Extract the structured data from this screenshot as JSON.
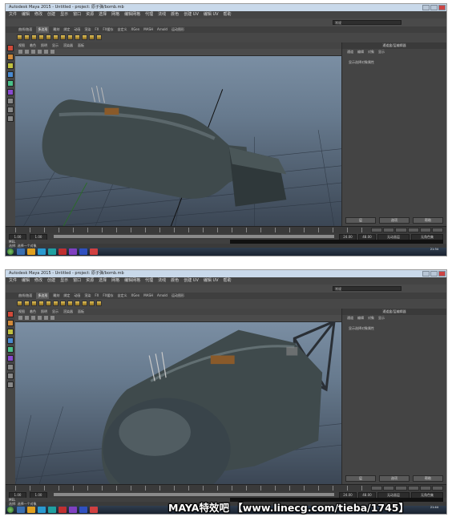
{
  "screens": [
    {
      "window_title": "Autodesk Maya 2015 - Untitled - project: 原子弹/bomb.mb",
      "menus": [
        "文件",
        "编辑",
        "修改",
        "创建",
        "显示",
        "窗口",
        "资源",
        "选择",
        "网格",
        "编辑网格",
        "代理",
        "法线",
        "颜色",
        "创建 UV",
        "编辑 UV",
        "帮助"
      ],
      "workspace": "常规",
      "shelf_tabs": [
        "曲线/曲面",
        "多边形",
        "雕刻",
        "绑定",
        "动画",
        "渲染",
        "FX",
        "FX缓存",
        "自定义",
        "XGen",
        "MASH",
        "Arnold",
        "运动图形"
      ],
      "active_shelf_tab": "多边形",
      "viewport_menus": [
        "视图",
        "着色",
        "照明",
        "显示",
        "渲染器",
        "面板"
      ],
      "channel_box_title": "通道盒/层编辑器",
      "channel_box_tabs": [
        "通道",
        "编辑",
        "对象",
        "显示"
      ],
      "channel_box_hint": "显示选择对象属性",
      "channel_box_buttons": [
        "层",
        "选项",
        "帮助"
      ],
      "time_start": "1.00",
      "time_end": "24.00",
      "range_end": "48.00",
      "anim_layer": "无动画层",
      "character_set": "无角色集",
      "command_label": "MEL",
      "help_text": "选择: 选择一个对象",
      "clock_time": "21:34",
      "clock_date": "2015/7/31"
    },
    {
      "window_title": "Autodesk Maya 2015 - Untitled - project: 原子弹/bomb.mb",
      "menus": [
        "文件",
        "编辑",
        "修改",
        "创建",
        "显示",
        "窗口",
        "资源",
        "选择",
        "网格",
        "编辑网格",
        "代理",
        "法线",
        "颜色",
        "创建 UV",
        "编辑 UV",
        "帮助"
      ],
      "workspace": "常规",
      "shelf_tabs": [
        "曲线/曲面",
        "多边形",
        "雕刻",
        "绑定",
        "动画",
        "渲染",
        "FX",
        "FX缓存",
        "自定义",
        "XGen",
        "MASH",
        "Arnold",
        "运动图形"
      ],
      "active_shelf_tab": "多边形",
      "viewport_menus": [
        "视图",
        "着色",
        "照明",
        "显示",
        "渲染器",
        "面板"
      ],
      "channel_box_title": "通道盒/层编辑器",
      "channel_box_tabs": [
        "通道",
        "编辑",
        "对象",
        "显示"
      ],
      "channel_box_hint": "显示选择对象属性",
      "channel_box_buttons": [
        "层",
        "选项",
        "帮助"
      ],
      "time_start": "1.00",
      "time_end": "24.00",
      "range_end": "48.00",
      "anim_layer": "无动画层",
      "character_set": "无角色集",
      "command_label": "MEL",
      "help_text": "选择: 选择一个对象",
      "clock_time": "21:44",
      "clock_date": "2015/7/31"
    }
  ],
  "watermark": "MAYA特效吧 【www.linecg.com/tieba/1745】",
  "colors": {
    "viewport_top": "#7f93a8",
    "viewport_bottom": "#3b4654",
    "bomb_body": "#3f4a4c",
    "bomb_highlight": "#6e7c80",
    "ui_dark": "#3c3c3c",
    "titlebar": "#c9d9ea"
  }
}
